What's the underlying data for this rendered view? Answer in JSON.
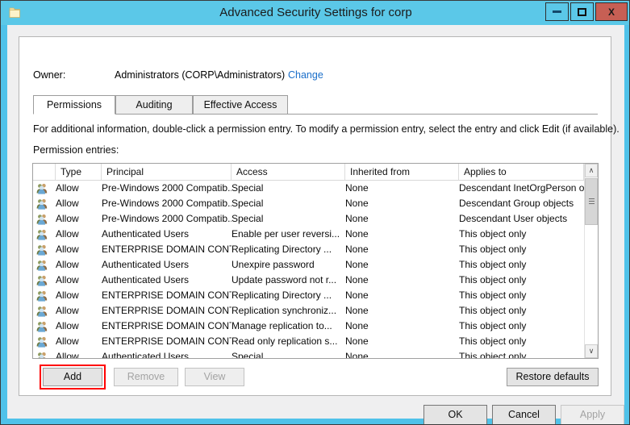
{
  "window": {
    "title": "Advanced Security Settings for corp",
    "icon": "folder-icon",
    "minimize_label": "",
    "maximize_label": "",
    "close_label": "X",
    "titlebar_color": "#5bc8e8",
    "close_color": "#c75f54"
  },
  "owner": {
    "label": "Owner:",
    "value": "Administrators (CORP\\Administrators)",
    "change_link": "Change",
    "link_color": "#1a6ec9"
  },
  "tabs": [
    {
      "label": "Permissions",
      "active": true
    },
    {
      "label": "Auditing",
      "active": false
    },
    {
      "label": "Effective Access",
      "active": false
    }
  ],
  "description": "For additional information, double-click a permission entry. To modify a permission entry, select the entry and click Edit (if available).",
  "entries_label": "Permission entries:",
  "table": {
    "columns": [
      "",
      "Type",
      "Principal",
      "Access",
      "Inherited from",
      "Applies to"
    ],
    "rows": [
      {
        "type": "Allow",
        "principal": "Pre-Windows 2000 Compatib...",
        "access": "Special",
        "inherited": "None",
        "applies": "Descendant InetOrgPerson o..."
      },
      {
        "type": "Allow",
        "principal": "Pre-Windows 2000 Compatib...",
        "access": "Special",
        "inherited": "None",
        "applies": "Descendant Group objects"
      },
      {
        "type": "Allow",
        "principal": "Pre-Windows 2000 Compatib...",
        "access": "Special",
        "inherited": "None",
        "applies": "Descendant User objects"
      },
      {
        "type": "Allow",
        "principal": "Authenticated Users",
        "access": "Enable per user reversi...",
        "inherited": "None",
        "applies": "This object only"
      },
      {
        "type": "Allow",
        "principal": "ENTERPRISE DOMAIN CONT...",
        "access": "Replicating Directory ...",
        "inherited": "None",
        "applies": "This object only"
      },
      {
        "type": "Allow",
        "principal": "Authenticated Users",
        "access": "Unexpire password",
        "inherited": "None",
        "applies": "This object only"
      },
      {
        "type": "Allow",
        "principal": "Authenticated Users",
        "access": "Update password not r...",
        "inherited": "None",
        "applies": "This object only"
      },
      {
        "type": "Allow",
        "principal": "ENTERPRISE DOMAIN CONT...",
        "access": "Replicating Directory ...",
        "inherited": "None",
        "applies": "This object only"
      },
      {
        "type": "Allow",
        "principal": "ENTERPRISE DOMAIN CONT...",
        "access": "Replication synchroniz...",
        "inherited": "None",
        "applies": "This object only"
      },
      {
        "type": "Allow",
        "principal": "ENTERPRISE DOMAIN CONT...",
        "access": "Manage replication to...",
        "inherited": "None",
        "applies": "This object only"
      },
      {
        "type": "Allow",
        "principal": "ENTERPRISE DOMAIN CONT...",
        "access": "Read only replication s...",
        "inherited": "None",
        "applies": "This object only"
      },
      {
        "type": "Allow",
        "principal": "Authenticated Users",
        "access": "Special",
        "inherited": "None",
        "applies": "This object only"
      }
    ],
    "scrollbar": {
      "up_arrow": "∧",
      "down_arrow": "∨"
    }
  },
  "actions": {
    "add": "Add",
    "remove": "Remove",
    "view": "View",
    "restore_defaults": "Restore defaults",
    "highlight_color": "#ff0000"
  },
  "footer": {
    "ok": "OK",
    "cancel": "Cancel",
    "apply": "Apply"
  }
}
